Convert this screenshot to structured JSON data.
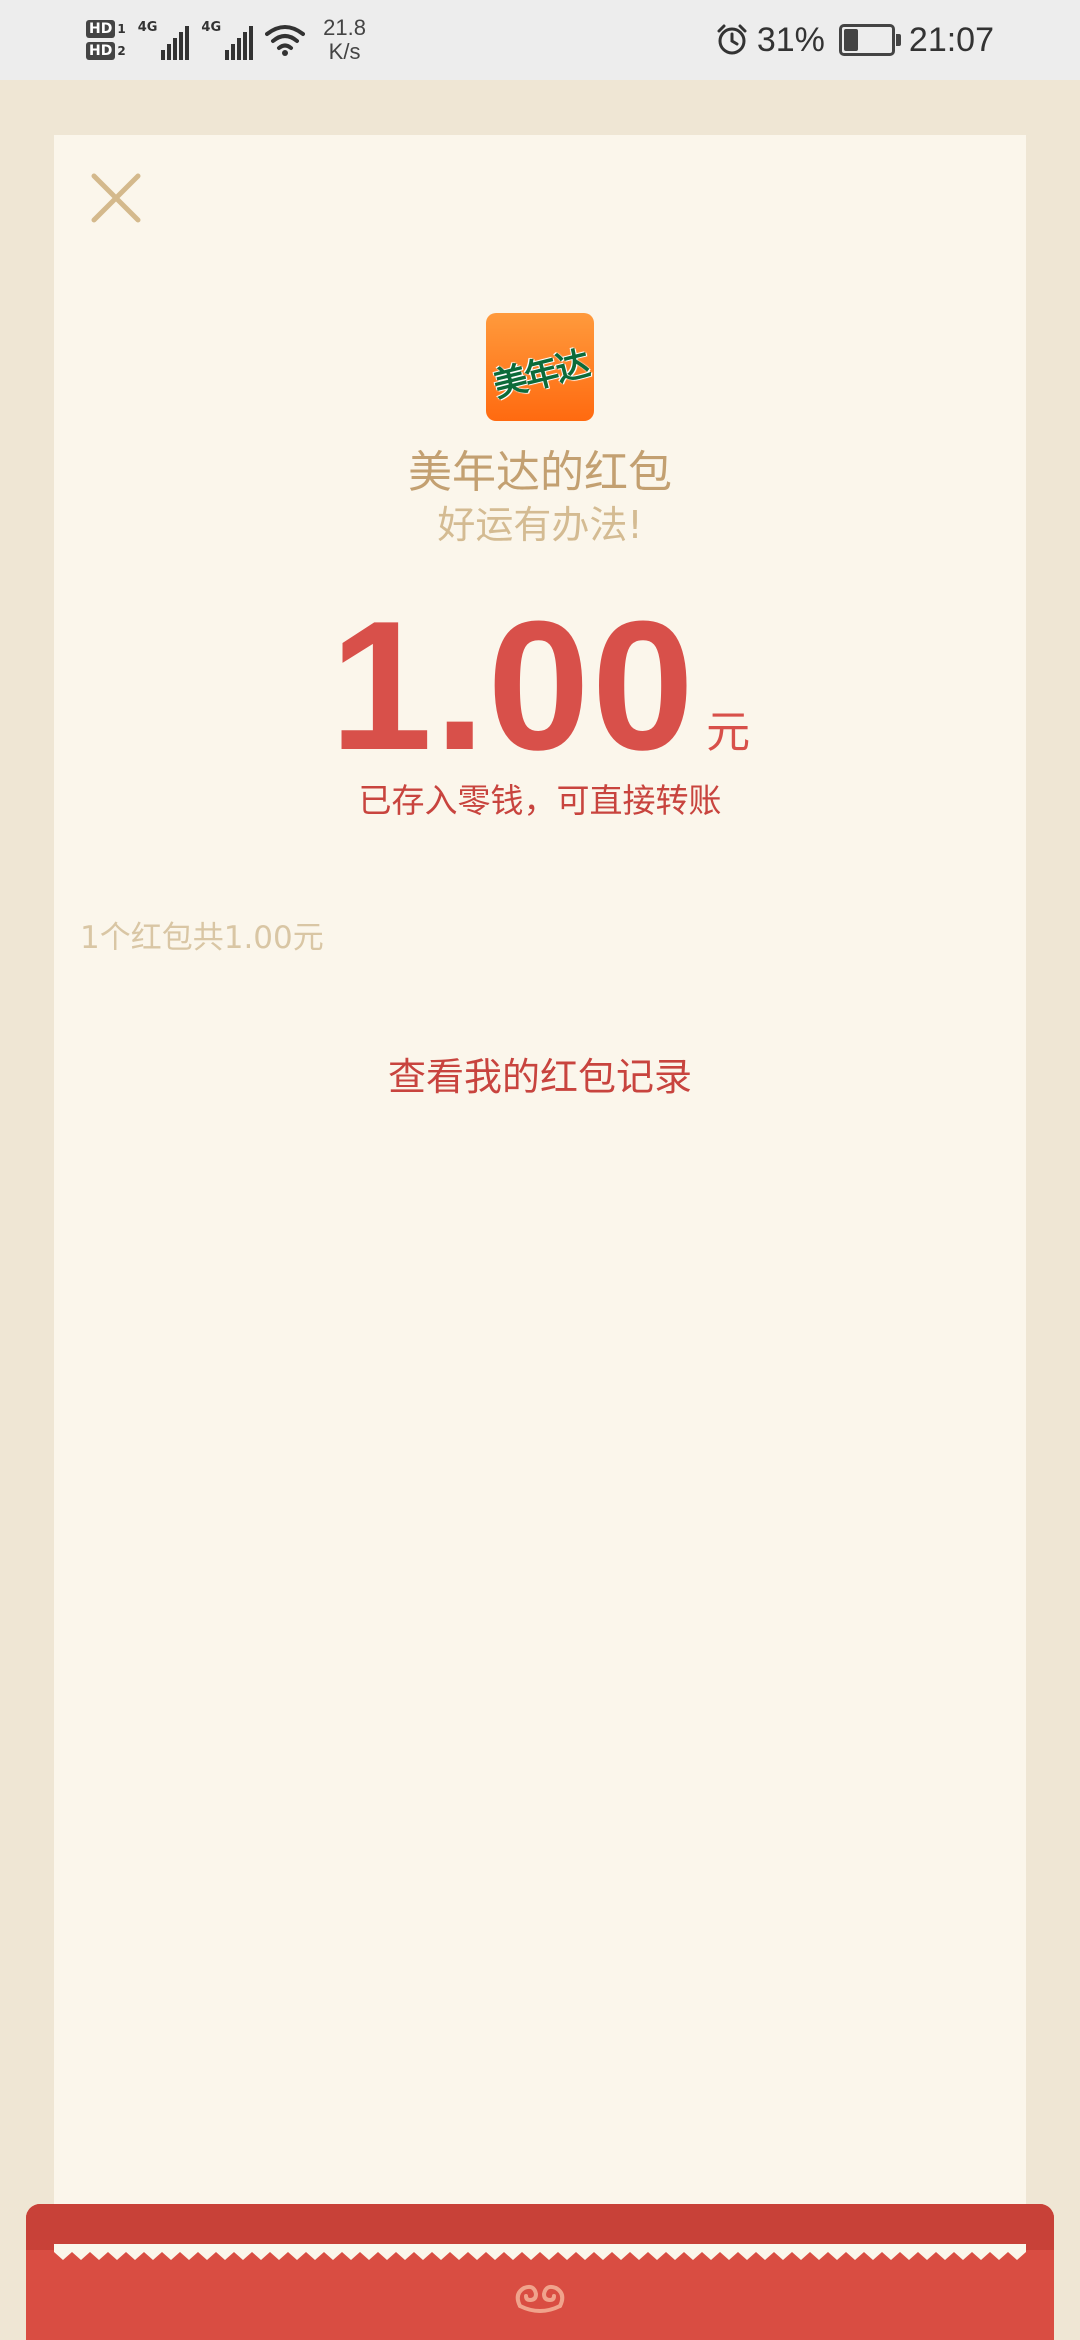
{
  "status_bar": {
    "hd1": "HD",
    "hd1_sub": "1",
    "hd2": "HD",
    "hd2_sub": "2",
    "net1": "4G",
    "net2": "4G",
    "speed_value": "21.8",
    "speed_unit": "K/s",
    "battery_percent": "31%",
    "battery_level": 0.31,
    "time": "21:07"
  },
  "envelope": {
    "close_icon": "close-icon",
    "logo_text": "美年达",
    "sender_title": "美年达的红包",
    "wish": "好运有办法!",
    "amount": "1.00",
    "unit": "元",
    "deposit_note": "已存入零钱，可直接转账",
    "summary": "1个红包共1.00元",
    "records_link": "查看我的红包记录"
  },
  "colors": {
    "accent_red": "#d8504a",
    "gold": "#c3a071",
    "card_bg": "#fbf6eb",
    "page_bg": "#efe6d4"
  }
}
